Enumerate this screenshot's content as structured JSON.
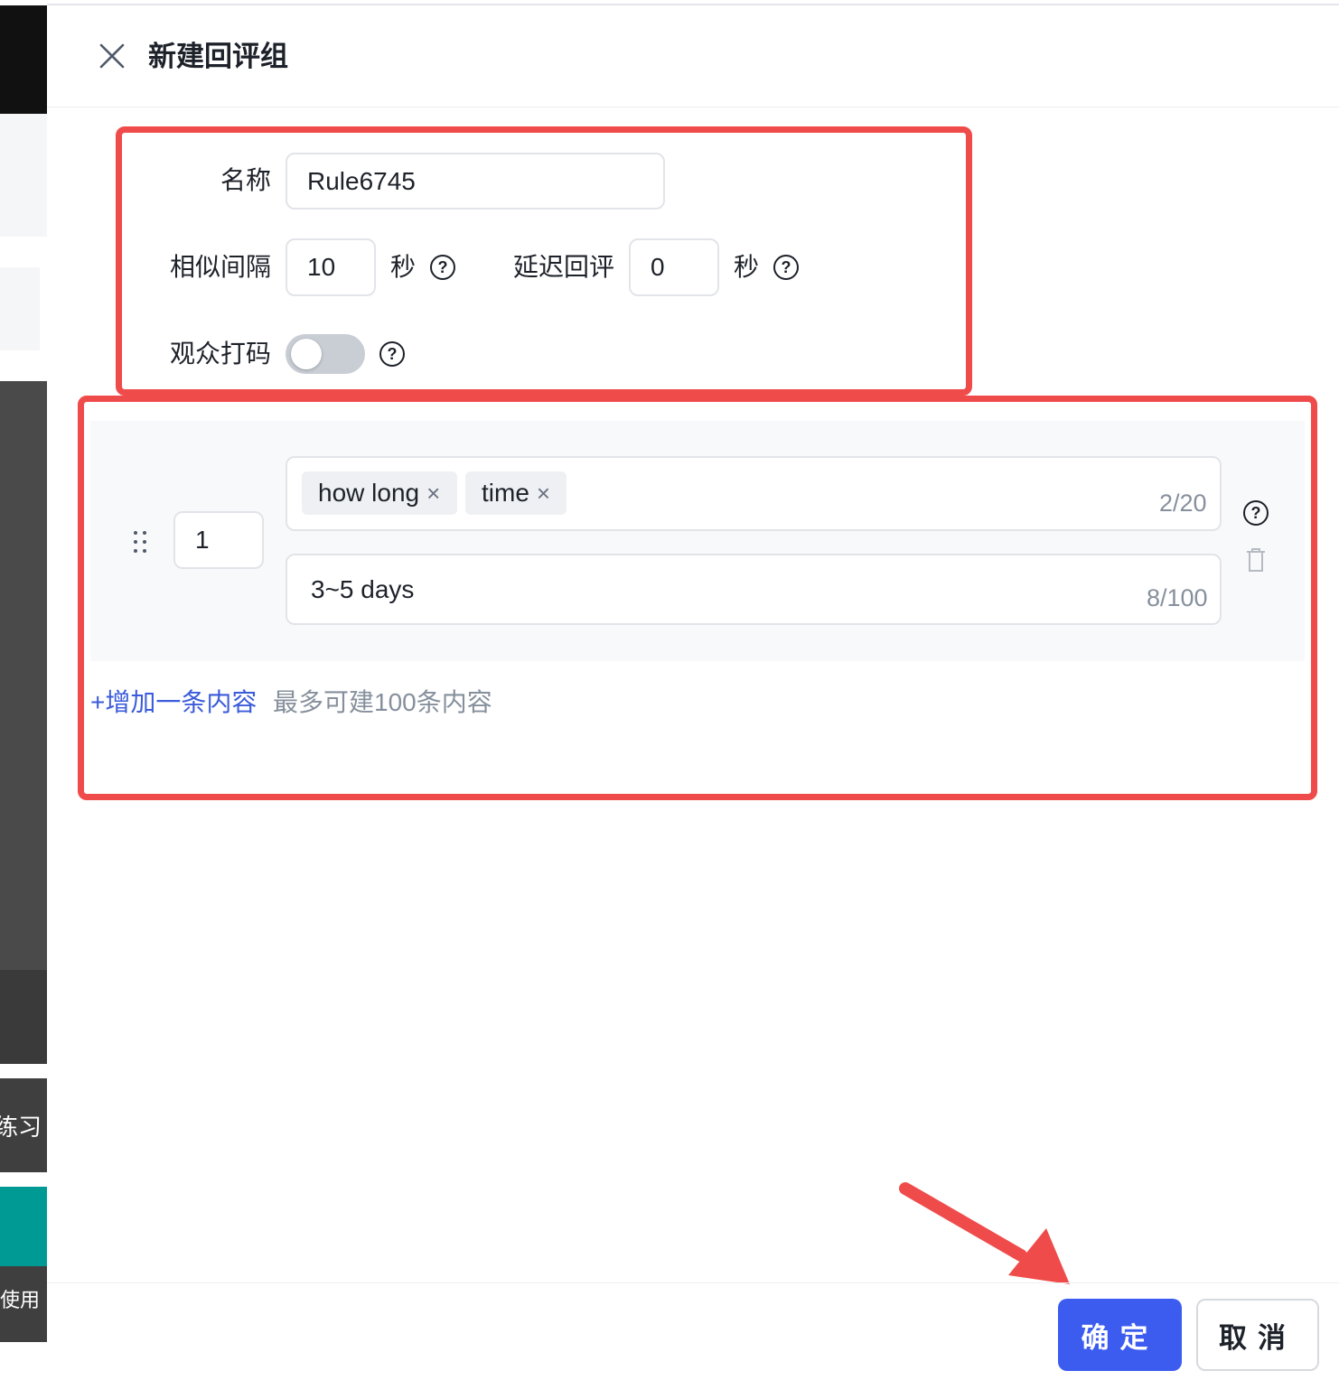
{
  "left_strip": {
    "labels": [
      "练习",
      "使用"
    ]
  },
  "drawer": {
    "title": "新建回评组",
    "close_icon": "close-icon"
  },
  "form": {
    "name_label": "名称",
    "name_value": "Rule6745",
    "similar_interval_label": "相似间隔",
    "similar_interval_value": "10",
    "similar_interval_unit": "秒",
    "delay_label": "延迟回评",
    "delay_value": "0",
    "delay_unit": "秒",
    "audience_mask_label": "观众打码",
    "audience_mask_on": false,
    "help_icon": "question-circle-icon",
    "help_glyph": "?"
  },
  "items": [
    {
      "order": "1",
      "keywords": [
        "how long",
        "time"
      ],
      "keyword_count": "2/20",
      "reply": "3~5 days",
      "reply_count": "8/100"
    }
  ],
  "add_item": {
    "link_text": "+增加一条内容",
    "hint": "最多可建100条内容"
  },
  "footer": {
    "confirm": "确定",
    "cancel": "取消"
  },
  "colors": {
    "primary": "#3c5cf0",
    "annotation_red": "#f04b4b",
    "link": "#3b5bdb"
  }
}
